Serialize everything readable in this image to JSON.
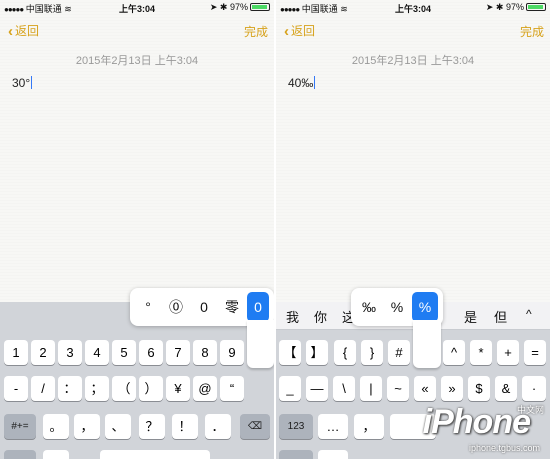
{
  "status": {
    "carrier": "中国联通",
    "time": "上午3:04",
    "battery": "97%"
  },
  "colors": {
    "accent": "#d7a21b",
    "selected": "#1f7cf2",
    "caret": "#3478f6"
  },
  "left": {
    "back_label": "返回",
    "done_label": "完成",
    "date": "2015年2月13日 上午3:04",
    "note_text": "30°",
    "popup": [
      "°",
      "⓪",
      "0",
      "零",
      "0"
    ],
    "rows": [
      [
        "1",
        "2",
        "3",
        "4",
        "5",
        "6",
        "7",
        "8",
        "9"
      ],
      [
        "-",
        "/",
        "：",
        "；",
        "（",
        "）",
        "¥",
        "@",
        "“"
      ],
      [
        "#+=",
        "。",
        "，",
        "、",
        "？",
        "！",
        "．"
      ]
    ]
  },
  "right": {
    "back_label": "返回",
    "done_label": "完成",
    "date": "2015年2月13日 上午3:04",
    "note_text": "40‰",
    "suggestions": [
      "我",
      "你",
      "这",
      "是",
      "但",
      "^"
    ],
    "popup": [
      "‰",
      "%",
      "%"
    ],
    "rows": [
      [
        "【",
        "】",
        "{",
        "}",
        "#",
        "^",
        "*",
        "+",
        "="
      ],
      [
        "_",
        "—",
        "\\",
        "|",
        "~",
        "«",
        "»",
        "$",
        "&",
        "·"
      ],
      [
        "123",
        "…",
        "，"
      ]
    ]
  },
  "watermark": {
    "brand": "iPhone",
    "site": "iphone.tgbus.com",
    "cn": "中文网"
  },
  "icons": {
    "back": "chevron-left-icon",
    "delete": "delete-icon",
    "wifi": "wifi-icon",
    "battery": "battery-icon",
    "bluetooth": "bluetooth-icon"
  }
}
